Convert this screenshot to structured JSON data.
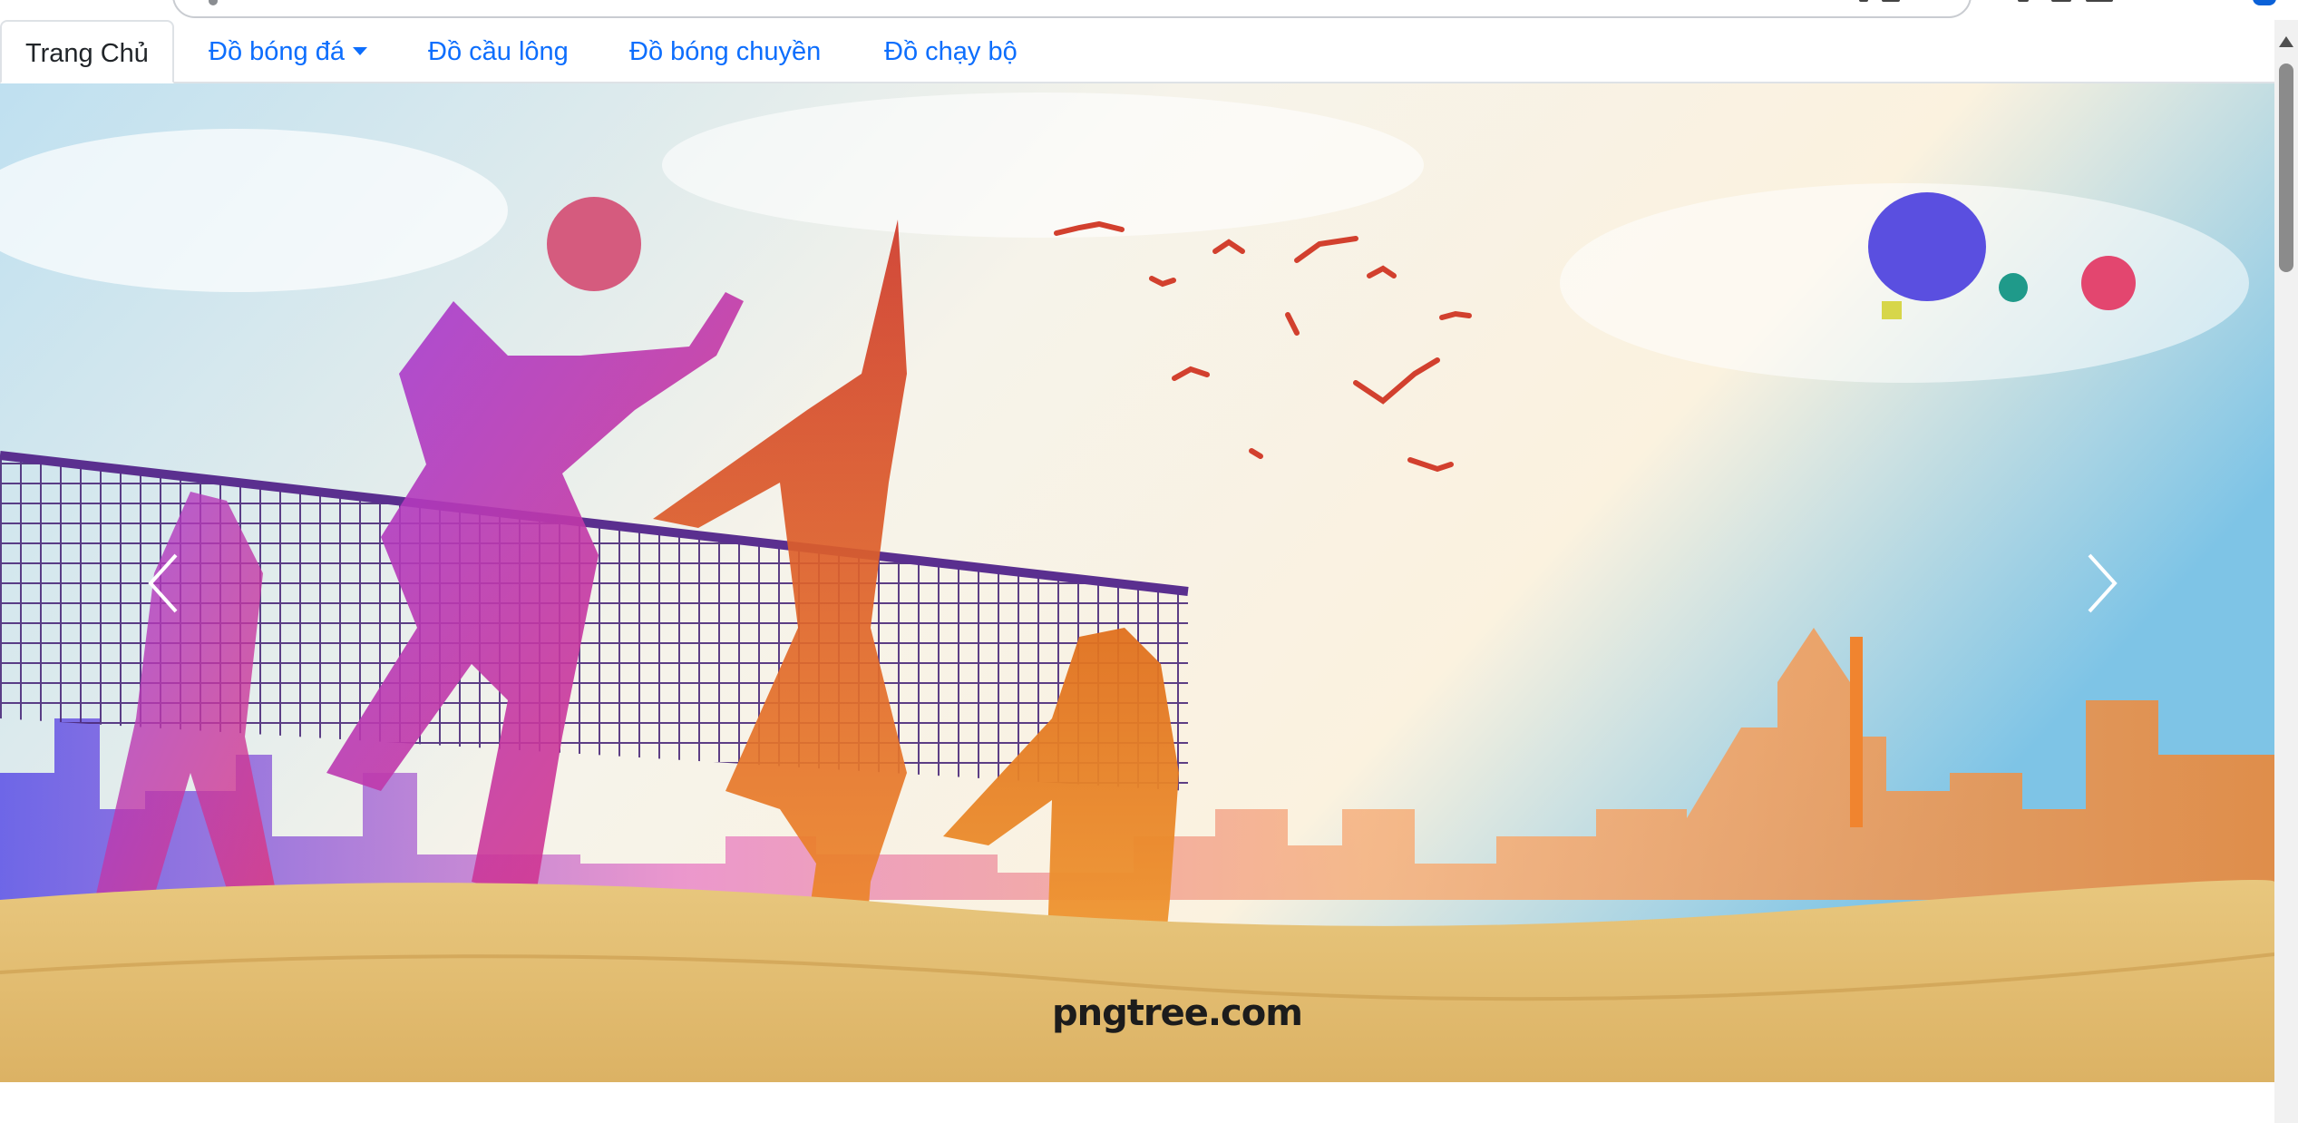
{
  "nav": {
    "tabs": [
      {
        "label": "Trang Chủ",
        "active": true
      },
      {
        "label": "Đồ bóng đá",
        "dropdown": true
      },
      {
        "label": "Đồ cầu lông"
      },
      {
        "label": "Đồ bóng chuyền"
      },
      {
        "label": "Đồ chạy bộ"
      }
    ]
  },
  "carousel": {
    "watermark": "pngtree.com",
    "prev_icon": "chevron-left-icon",
    "next_icon": "chevron-right-icon"
  },
  "colors": {
    "link": "#0d6efd",
    "active_tab_text": "#212529",
    "tab_border": "#dee2e6",
    "sand": "#e3bf73",
    "sky": "#cfe7f3"
  }
}
